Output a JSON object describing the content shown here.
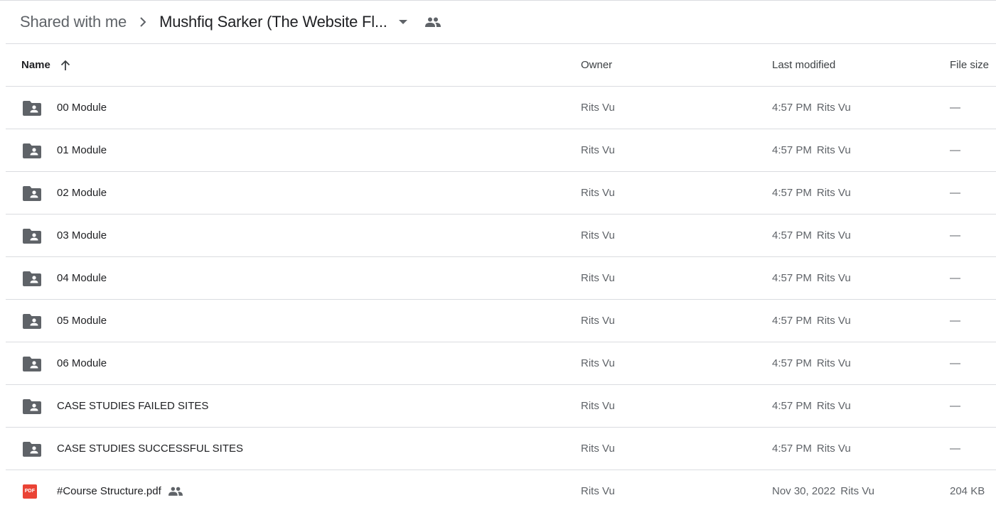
{
  "breadcrumb": {
    "root": "Shared with me",
    "current": "Mushfiq Sarker (The Website Fl..."
  },
  "columns": {
    "name": "Name",
    "owner": "Owner",
    "last_modified": "Last modified",
    "file_size": "File size"
  },
  "icons": {
    "folder": "shared-folder-icon",
    "pdf": "pdf-icon",
    "pdf_label": "PDF",
    "shared": "people-icon",
    "sort": "arrow-up-icon"
  },
  "colors": {
    "pdf_red": "#ea4335",
    "icon_gray": "#5f6368"
  },
  "files": [
    {
      "name": "00 Module",
      "type": "folder",
      "owner": "Rits Vu",
      "modified_time": "4:57 PM",
      "modified_by": "Rits Vu",
      "size": "—"
    },
    {
      "name": "01 Module",
      "type": "folder",
      "owner": "Rits Vu",
      "modified_time": "4:57 PM",
      "modified_by": "Rits Vu",
      "size": "—"
    },
    {
      "name": "02 Module",
      "type": "folder",
      "owner": "Rits Vu",
      "modified_time": "4:57 PM",
      "modified_by": "Rits Vu",
      "size": "—"
    },
    {
      "name": "03 Module",
      "type": "folder",
      "owner": "Rits Vu",
      "modified_time": "4:57 PM",
      "modified_by": "Rits Vu",
      "size": "—"
    },
    {
      "name": "04 Module",
      "type": "folder",
      "owner": "Rits Vu",
      "modified_time": "4:57 PM",
      "modified_by": "Rits Vu",
      "size": "—"
    },
    {
      "name": "05 Module",
      "type": "folder",
      "owner": "Rits Vu",
      "modified_time": "4:57 PM",
      "modified_by": "Rits Vu",
      "size": "—"
    },
    {
      "name": "06 Module",
      "type": "folder",
      "owner": "Rits Vu",
      "modified_time": "4:57 PM",
      "modified_by": "Rits Vu",
      "size": "—"
    },
    {
      "name": "CASE STUDIES FAILED SITES",
      "type": "folder",
      "owner": "Rits Vu",
      "modified_time": "4:57 PM",
      "modified_by": "Rits Vu",
      "size": "—"
    },
    {
      "name": "CASE STUDIES SUCCESSFUL SITES",
      "type": "folder",
      "owner": "Rits Vu",
      "modified_time": "4:57 PM",
      "modified_by": "Rits Vu",
      "size": "—"
    },
    {
      "name": "#Course Structure.pdf",
      "type": "pdf",
      "shared": true,
      "owner": "Rits Vu",
      "modified_time": "Nov 30, 2022",
      "modified_by": "Rits Vu",
      "size": "204 KB"
    }
  ]
}
